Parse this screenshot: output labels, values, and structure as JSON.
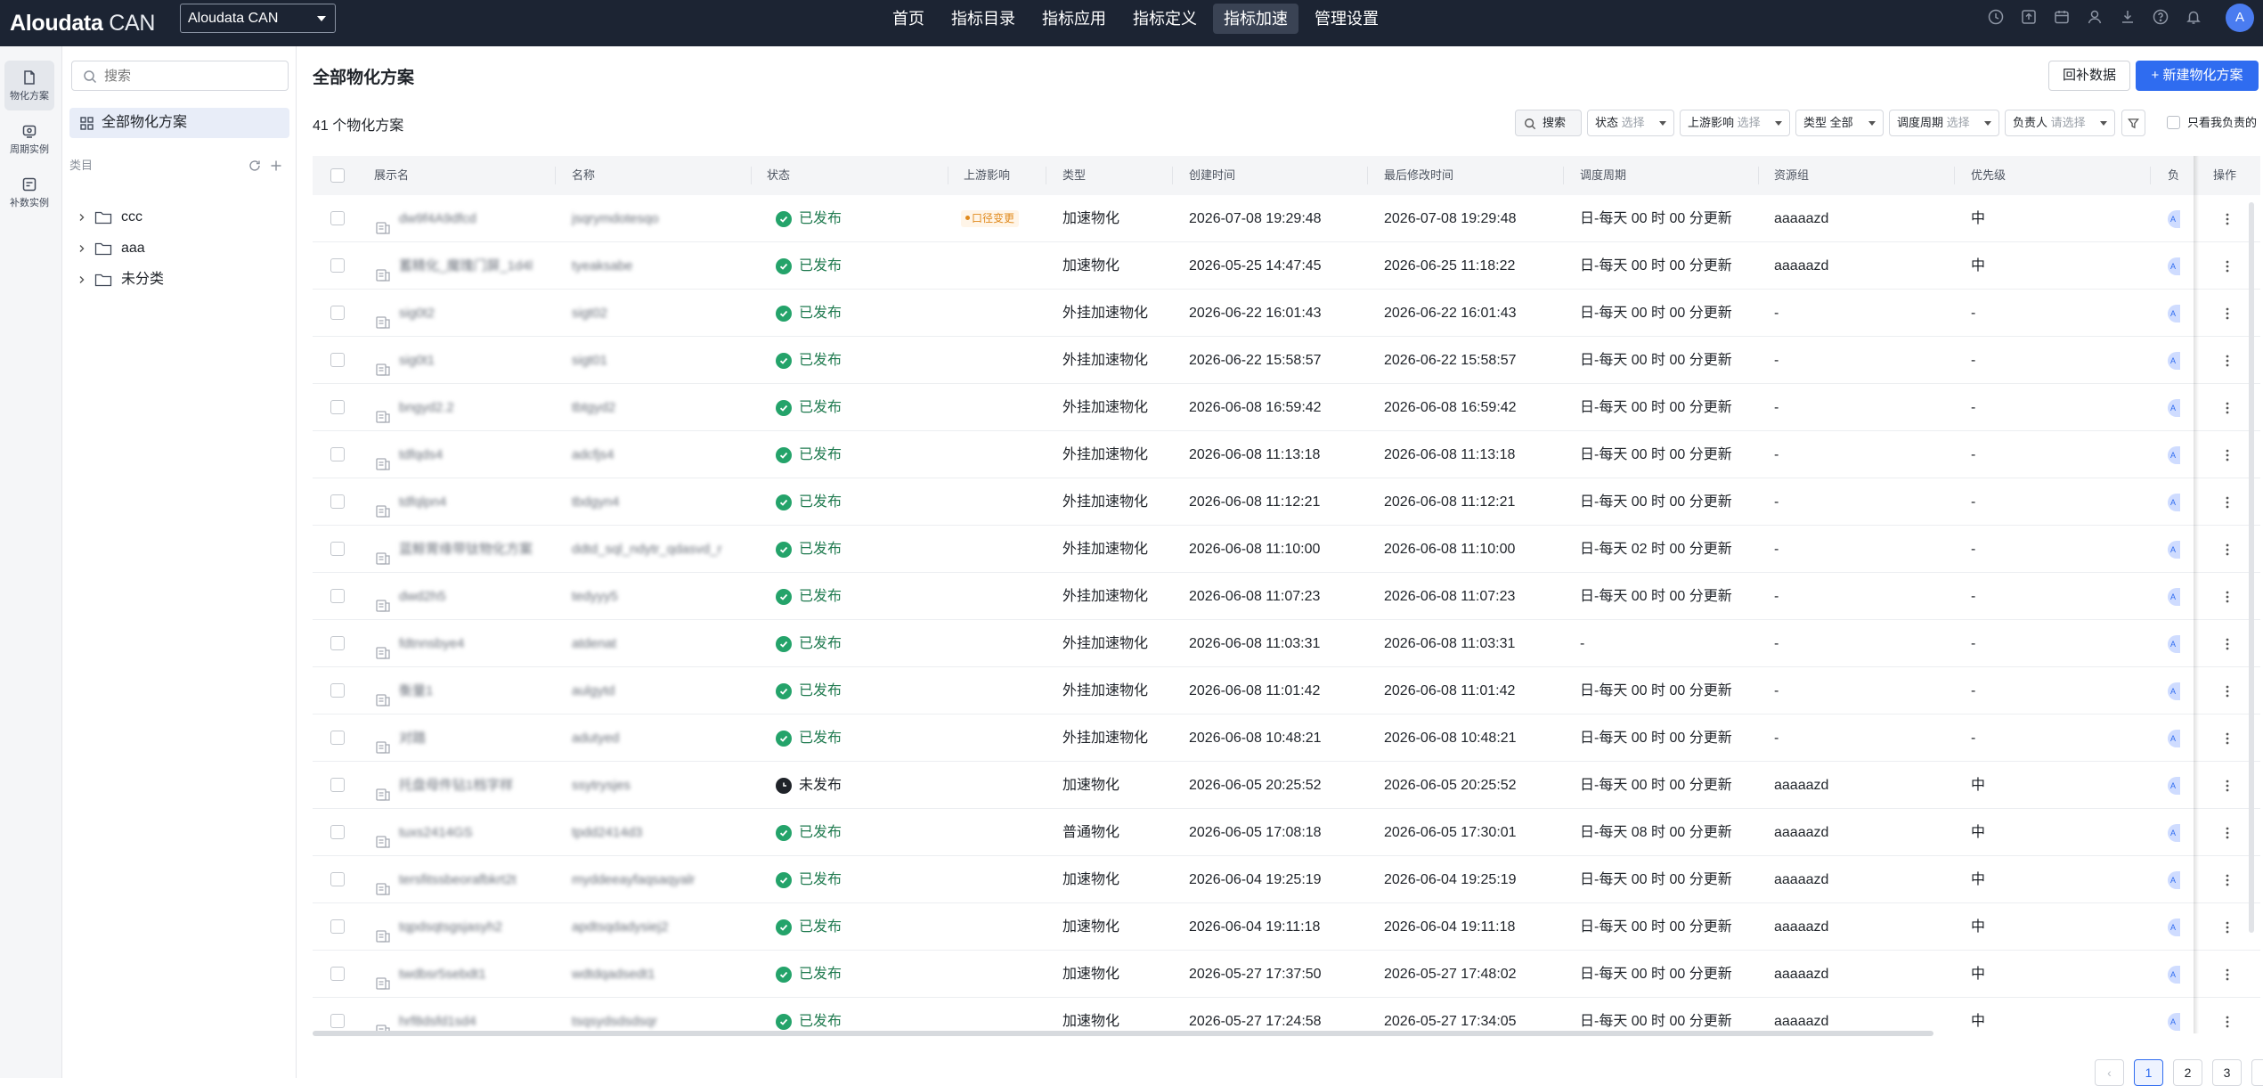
{
  "app": {
    "logo_brand": "Aloudata",
    "logo_product": "CAN",
    "workspace": "Aloudata CAN",
    "avatar_initial": "A"
  },
  "nav": [
    "首页",
    "指标目录",
    "指标应用",
    "指标定义",
    "指标加速",
    "管理设置"
  ],
  "nav_active": "指标加速",
  "rail": [
    {
      "label": "物化方案",
      "icon": "document-icon"
    },
    {
      "label": "周期实例",
      "icon": "cycle-icon"
    },
    {
      "label": "补数实例",
      "icon": "backfill-icon"
    }
  ],
  "catalog": {
    "search_placeholder": "搜索",
    "all_label": "全部物化方案",
    "section_label": "类目",
    "folders": [
      "ccc",
      "aaa",
      "未分类"
    ]
  },
  "page": {
    "title": "全部物化方案",
    "backfill_button": "回补数据",
    "new_button": "+ 新建物化方案",
    "count_text": "41 个物化方案"
  },
  "filters": {
    "search": "搜索",
    "status_label": "状态",
    "status_value": "选择",
    "upstream_label": "上游影响",
    "upstream_value": "选择",
    "type_label": "类型",
    "type_value": "全部",
    "schedule_label": "调度周期",
    "schedule_value": "选择",
    "owner_label": "负责人",
    "owner_value": "请选择",
    "only_mine": "只看我负责的"
  },
  "columns": {
    "display_name": "展示名",
    "name": "名称",
    "status": "状态",
    "upstream": "上游影响",
    "type": "类型",
    "created": "创建时间",
    "modified": "最后修改时间",
    "schedule": "调度周期",
    "resource": "资源组",
    "priority": "优先级",
    "owner": "负",
    "actions": "操作"
  },
  "rows": [
    {
      "display": "dw9f4A9dfcd",
      "name": "jsqrymdotesqo",
      "status": "已发布",
      "published": true,
      "upstream": "口径变更",
      "type": "加速物化",
      "created": "2026-07-08 19:29:48",
      "modified": "2026-07-08 19:29:48",
      "schedule": "日-每天 00 时 00 分更新",
      "resource": "aaaaazd",
      "priority": "中",
      "owner": "A"
    },
    {
      "display": "蓄精化_魔瑰门屏_1d4l",
      "name": "tyeaksabe",
      "status": "已发布",
      "published": true,
      "upstream": "",
      "type": "加速物化",
      "created": "2026-05-25 14:47:45",
      "modified": "2026-06-25 11:18:22",
      "schedule": "日-每天 00 时 00 分更新",
      "resource": "aaaaazd",
      "priority": "中",
      "owner": "A"
    },
    {
      "display": "sig0t2",
      "name": "sigt02",
      "status": "已发布",
      "published": true,
      "upstream": "",
      "type": "外挂加速物化",
      "created": "2026-06-22 16:01:43",
      "modified": "2026-06-22 16:01:43",
      "schedule": "日-每天 00 时 00 分更新",
      "resource": "-",
      "priority": "-",
      "owner": "A"
    },
    {
      "display": "sig0t1",
      "name": "sigt01",
      "status": "已发布",
      "published": true,
      "upstream": "",
      "type": "外挂加速物化",
      "created": "2026-06-22 15:58:57",
      "modified": "2026-06-22 15:58:57",
      "schedule": "日-每天 00 时 00 分更新",
      "resource": "-",
      "priority": "-",
      "owner": "A"
    },
    {
      "display": "bngyd2.2",
      "name": "tbtgyd2",
      "status": "已发布",
      "published": true,
      "upstream": "",
      "type": "外挂加速物化",
      "created": "2026-06-08 16:59:42",
      "modified": "2026-06-08 16:59:42",
      "schedule": "日-每天 00 时 00 分更新",
      "resource": "-",
      "priority": "-",
      "owner": "A"
    },
    {
      "display": "tdfqds4",
      "name": "adcfjs4",
      "status": "已发布",
      "published": true,
      "upstream": "",
      "type": "外挂加速物化",
      "created": "2026-06-08 11:13:18",
      "modified": "2026-06-08 11:13:18",
      "schedule": "日-每天 00 时 00 分更新",
      "resource": "-",
      "priority": "-",
      "owner": "A"
    },
    {
      "display": "tdfqlpn4",
      "name": "tbdgyn4",
      "status": "已发布",
      "published": true,
      "upstream": "",
      "type": "外挂加速物化",
      "created": "2026-06-08 11:12:21",
      "modified": "2026-06-08 11:12:21",
      "schedule": "日-每天 00 时 00 分更新",
      "resource": "-",
      "priority": "-",
      "owner": "A"
    },
    {
      "display": "蓝鲸胃缘带钛物化方案",
      "name": "ddtd_sql_ndytr_qdasvd_r",
      "status": "已发布",
      "published": true,
      "upstream": "",
      "type": "外挂加速物化",
      "created": "2026-06-08 11:10:00",
      "modified": "2026-06-08 11:10:00",
      "schedule": "日-每天 02 时 00 分更新",
      "resource": "-",
      "priority": "-",
      "owner": "A"
    },
    {
      "display": "dwd2h5",
      "name": "tedyyy5",
      "status": "已发布",
      "published": true,
      "upstream": "",
      "type": "外挂加速物化",
      "created": "2026-06-08 11:07:23",
      "modified": "2026-06-08 11:07:23",
      "schedule": "日-每天 00 时 00 分更新",
      "resource": "-",
      "priority": "-",
      "owner": "A"
    },
    {
      "display": "fdtnnsbye4",
      "name": "atdenat",
      "status": "已发布",
      "published": true,
      "upstream": "",
      "type": "外挂加速物化",
      "created": "2026-06-08 11:03:31",
      "modified": "2026-06-08 11:03:31",
      "schedule": "-",
      "resource": "-",
      "priority": "-",
      "owner": "A"
    },
    {
      "display": "衡量1",
      "name": "aulgytd",
      "status": "已发布",
      "published": true,
      "upstream": "",
      "type": "外挂加速物化",
      "created": "2026-06-08 11:01:42",
      "modified": "2026-06-08 11:01:42",
      "schedule": "日-每天 00 时 00 分更新",
      "resource": "-",
      "priority": "-",
      "owner": "A"
    },
    {
      "display": "对踏",
      "name": "adutyed",
      "status": "已发布",
      "published": true,
      "upstream": "",
      "type": "外挂加速物化",
      "created": "2026-06-08 10:48:21",
      "modified": "2026-06-08 10:48:21",
      "schedule": "日-每天 00 时 00 分更新",
      "resource": "-",
      "priority": "-",
      "owner": "A"
    },
    {
      "display": "托盘母件钻1档字样",
      "name": "ssytrysjes",
      "status": "未发布",
      "published": false,
      "upstream": "",
      "type": "加速物化",
      "created": "2026-06-05 20:25:52",
      "modified": "2026-06-05 20:25:52",
      "schedule": "日-每天 00 时 00 分更新",
      "resource": "aaaaazd",
      "priority": "中",
      "owner": "A"
    },
    {
      "display": "tuxs2414GS",
      "name": "tpdd2414d3",
      "status": "已发布",
      "published": true,
      "upstream": "",
      "type": "普通物化",
      "created": "2026-06-05 17:08:18",
      "modified": "2026-06-05 17:30:01",
      "schedule": "日-每天 08 时 00 分更新",
      "resource": "aaaaazd",
      "priority": "中",
      "owner": "A"
    },
    {
      "display": "tersfitssbeorafbkrt2t",
      "name": "myddeeayfaqsaqyalr",
      "status": "已发布",
      "published": true,
      "upstream": "",
      "type": "加速物化",
      "created": "2026-06-04 19:25:19",
      "modified": "2026-06-04 19:25:19",
      "schedule": "日-每天 00 时 00 分更新",
      "resource": "aaaaazd",
      "priority": "中",
      "owner": "A"
    },
    {
      "display": "tqpdsqtsgsjasyh2",
      "name": "apdtsqdadysiej2",
      "status": "已发布",
      "published": true,
      "upstream": "",
      "type": "加速物化",
      "created": "2026-06-04 19:11:18",
      "modified": "2026-06-04 19:11:18",
      "schedule": "日-每天 00 时 00 分更新",
      "resource": "aaaaazd",
      "priority": "中",
      "owner": "A"
    },
    {
      "display": "twdbsr5sebdt1",
      "name": "wdtdqadsedt1",
      "status": "已发布",
      "published": true,
      "upstream": "",
      "type": "加速物化",
      "created": "2026-05-27 17:37:50",
      "modified": "2026-05-27 17:48:02",
      "schedule": "日-每天 00 时 00 分更新",
      "resource": "aaaaazd",
      "priority": "中",
      "owner": "A"
    },
    {
      "display": "hrf8dsfd1sd4",
      "name": "tsqsydsdsdsqr",
      "status": "已发布",
      "published": true,
      "upstream": "",
      "type": "加速物化",
      "created": "2026-05-27 17:24:58",
      "modified": "2026-05-27 17:34:05",
      "schedule": "日-每天 00 时 00 分更新",
      "resource": "aaaaazd",
      "priority": "中",
      "owner": "A"
    }
  ],
  "pagination": {
    "pages": [
      "1",
      "2",
      "3"
    ],
    "current": "1",
    "prev": "‹",
    "next": "›"
  },
  "colors": {
    "topbar": "#1c2433",
    "primary": "#2f6cf0",
    "published": "#24a36a",
    "upstream_warning": "#e08a1d"
  }
}
